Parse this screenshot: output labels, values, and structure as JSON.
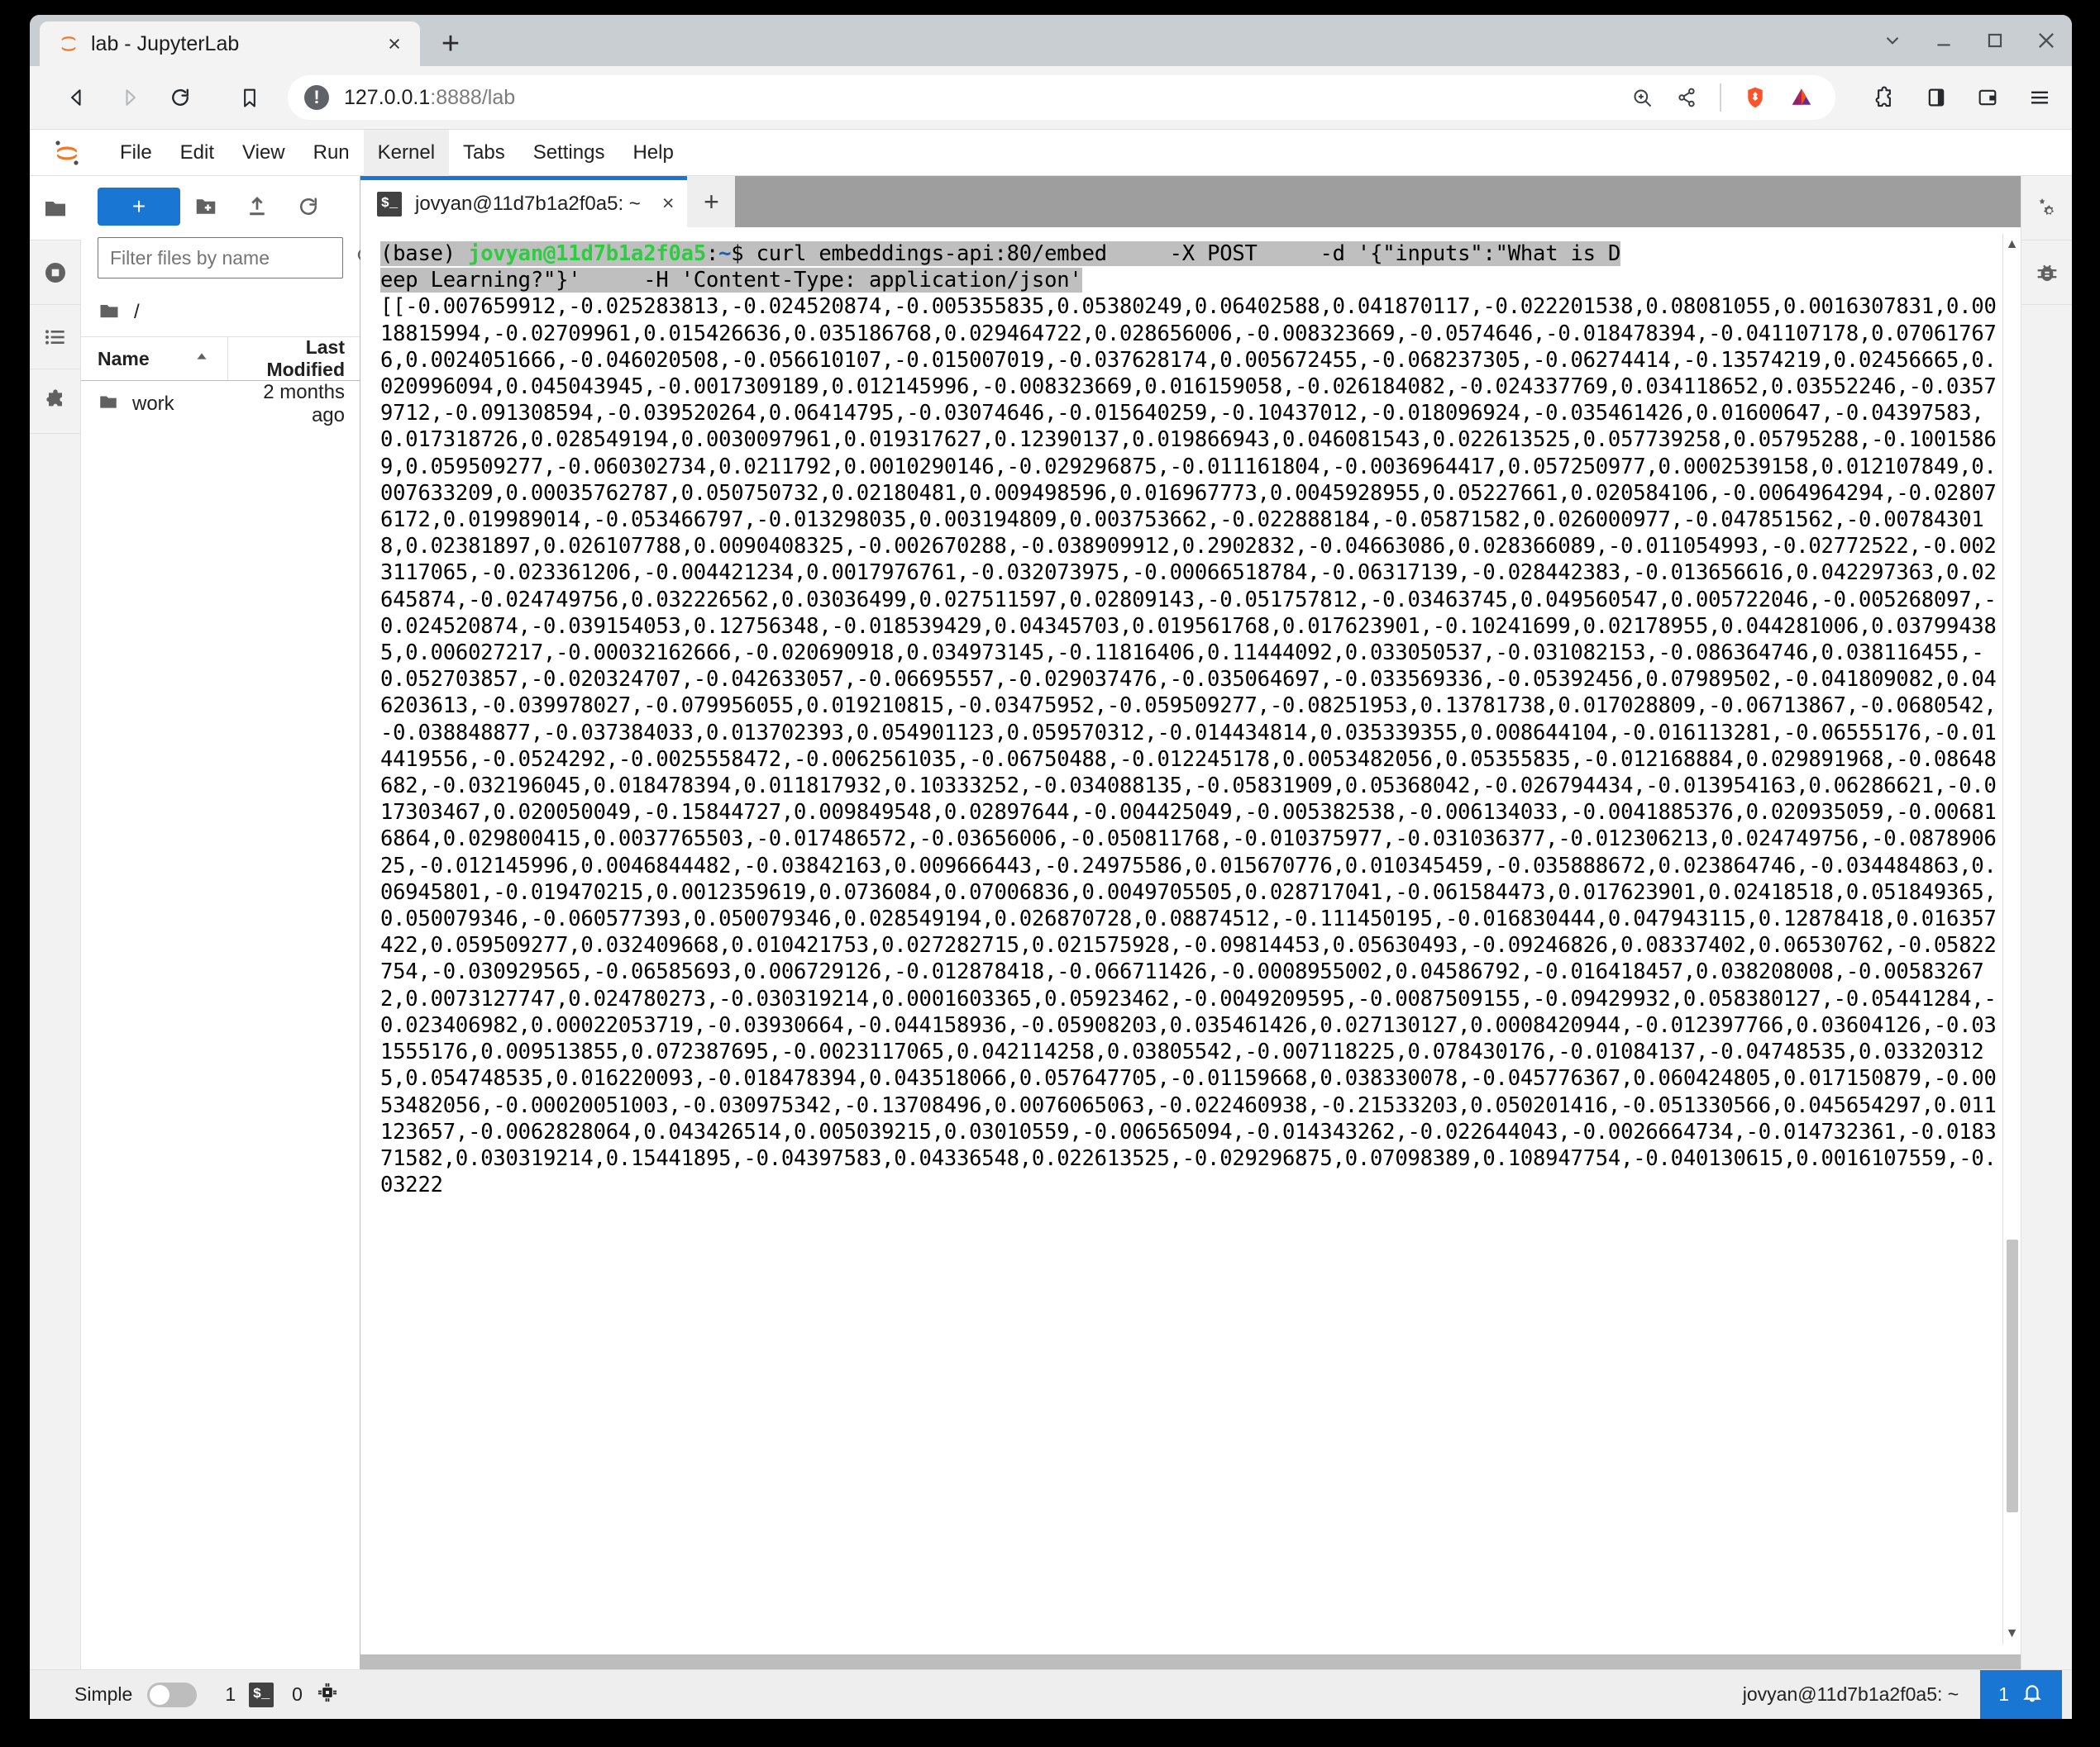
{
  "browser": {
    "tab": {
      "title": "lab - JupyterLab",
      "favicon": "jupyter-logo-icon",
      "close": "×"
    },
    "new_tab_label": "+",
    "window_controls": {
      "tab_search": "chevron-down-icon",
      "minimize": "minimize-icon",
      "maximize": "maximize-icon",
      "close": "close-icon"
    },
    "nav": {
      "back": "back-arrow-icon",
      "forward": "forward-arrow-icon",
      "reload": "reload-icon",
      "bookmark": "bookmark-icon"
    },
    "url": {
      "host": "127.0.0.1",
      "path": ":8888/lab",
      "full": "127.0.0.1:8888/lab",
      "info_icon": "info-circle-icon"
    },
    "url_icons": [
      "zoom-icon",
      "share-icon",
      "brave-shield-icon",
      "bat-rewards-icon"
    ],
    "toolbar_icons": [
      "extensions-puzzle-icon",
      "sidebar-panel-icon",
      "wallet-icon",
      "hamburger-menu-icon"
    ],
    "accent": "#1976d2",
    "brave_orange": "#fb542b"
  },
  "jupyter": {
    "logo": "jupyter-logo-icon",
    "menu": [
      {
        "label": "File",
        "active": false
      },
      {
        "label": "Edit",
        "active": false
      },
      {
        "label": "View",
        "active": false
      },
      {
        "label": "Run",
        "active": false
      },
      {
        "label": "Kernel",
        "active": true
      },
      {
        "label": "Tabs",
        "active": false
      },
      {
        "label": "Settings",
        "active": false
      },
      {
        "label": "Help",
        "active": false
      }
    ],
    "left_activitybar": [
      {
        "name": "file-browser",
        "icon": "folder-icon",
        "active": true
      },
      {
        "name": "running-terminals",
        "icon": "stop-circle-icon",
        "active": false
      },
      {
        "name": "table-of-contents",
        "icon": "list-icon",
        "active": false
      },
      {
        "name": "extension-manager",
        "icon": "puzzle-icon",
        "active": false
      }
    ],
    "right_activitybar": [
      {
        "name": "property-inspector",
        "icon": "gears-icon"
      },
      {
        "name": "debugger",
        "icon": "bug-icon"
      }
    ],
    "filebrowser": {
      "new_launcher_label": "+",
      "tools": [
        {
          "name": "new-folder",
          "icon": "new-folder-icon"
        },
        {
          "name": "upload",
          "icon": "upload-icon"
        },
        {
          "name": "refresh",
          "icon": "refresh-icon"
        }
      ],
      "filter_placeholder": "Filter files by name",
      "filter_value": "",
      "search_icon": "search-icon",
      "breadcrumb": "/",
      "columns": {
        "name": "Name",
        "last_modified": "Last Modified"
      },
      "sort_icon": "sort-ascending-icon",
      "rows": [
        {
          "name": "work",
          "icon": "folder-icon",
          "last_modified": "2 months ago"
        }
      ]
    },
    "main_tab": {
      "label": "jovyan@11d7b1a2f0a5: ~",
      "icon": "terminal-icon",
      "icon_glyph": "$_",
      "close": "×",
      "add_label": "+"
    },
    "statusbar": {
      "simple_label": "Simple",
      "simple_enabled": false,
      "terminals_count": "1",
      "terminal_icon": "terminal-icon",
      "kernels_count": "0",
      "kernel_icon": "cpu-chip-icon",
      "kernel_name": "jovyan@11d7b1a2f0a5: ~",
      "notification_count": "1",
      "notification_icon": "bell-icon"
    }
  },
  "terminal": {
    "prompt": {
      "base": "(base) ",
      "user_host": "jovyan@11d7b1a2f0a5",
      "colon": ":",
      "tilde": "~",
      "dollar": "$ "
    },
    "command_line1": "curl embeddings-api:80/embed     -X POST     -d '{\"inputs\":\"What is D",
    "command_line2": "eep Learning?\"}'     -H 'Content-Type: application/json'",
    "output": "[[-0.007659912,-0.025283813,-0.024520874,-0.005355835,0.05380249,0.06402588,0.041870117,-0.022201538,0.08081055,0.0016307831,0.0018815994,-0.02709961,0.015426636,0.035186768,0.029464722,0.028656006,-0.008323669,-0.0574646,-0.018478394,-0.041107178,0.070617676,0.0024051666,-0.046020508,-0.056610107,-0.015007019,-0.037628174,0.005672455,-0.068237305,-0.06274414,-0.13574219,0.02456665,0.020996094,0.045043945,-0.0017309189,0.012145996,-0.008323669,0.016159058,-0.026184082,-0.024337769,0.034118652,0.03552246,-0.03579712,-0.091308594,-0.039520264,0.06414795,-0.03074646,-0.015640259,-0.10437012,-0.018096924,-0.035461426,0.01600647,-0.04397583,0.017318726,0.028549194,0.0030097961,0.019317627,0.12390137,0.019866943,0.046081543,0.022613525,0.057739258,0.05795288,-0.10015869,0.059509277,-0.060302734,0.0211792,0.0010290146,-0.029296875,-0.011161804,-0.0036964417,0.057250977,0.0002539158,0.012107849,0.007633209,0.00035762787,0.050750732,0.02180481,0.009498596,0.016967773,0.0045928955,0.05227661,0.020584106,-0.0064964294,-0.028076172,0.019989014,-0.053466797,-0.013298035,0.003194809,0.003753662,-0.022888184,-0.05871582,0.026000977,-0.047851562,-0.007843018,0.02381897,0.026107788,0.0090408325,-0.002670288,-0.038909912,0.2902832,-0.04663086,0.028366089,-0.011054993,-0.02772522,-0.0023117065,-0.023361206,-0.004421234,0.0017976761,-0.032073975,-0.00066518784,-0.06317139,-0.028442383,-0.013656616,0.042297363,0.02645874,-0.024749756,0.032226562,0.03036499,0.027511597,0.02809143,-0.051757812,-0.03463745,0.049560547,0.005722046,-0.005268097,-0.024520874,-0.039154053,0.12756348,-0.018539429,0.04345703,0.019561768,0.017623901,-0.10241699,0.02178955,0.044281006,0.037994385,0.006027217,-0.00032162666,-0.020690918,0.034973145,-0.11816406,0.11444092,0.033050537,-0.031082153,-0.086364746,0.038116455,-0.052703857,-0.020324707,-0.042633057,-0.06695557,-0.029037476,-0.035064697,-0.033569336,-0.05392456,0.07989502,-0.041809082,0.046203613,-0.039978027,-0.079956055,0.019210815,-0.03475952,-0.059509277,-0.08251953,0.13781738,0.017028809,-0.06713867,-0.0680542,-0.038848877,-0.037384033,0.013702393,0.054901123,0.059570312,-0.014434814,0.035339355,0.008644104,-0.016113281,-0.06555176,-0.014419556,-0.0524292,-0.0025558472,-0.0062561035,-0.06750488,-0.012245178,0.0053482056,0.05355835,-0.012168884,0.029891968,-0.08648682,-0.032196045,0.018478394,0.011817932,0.10333252,-0.034088135,-0.05831909,0.05368042,-0.026794434,-0.013954163,0.06286621,-0.017303467,0.020050049,-0.15844727,0.009849548,0.02897644,-0.004425049,-0.005382538,-0.006134033,-0.0041885376,0.020935059,-0.006816864,0.029800415,0.0037765503,-0.017486572,-0.03656006,-0.050811768,-0.010375977,-0.031036377,-0.012306213,0.024749756,-0.087890625,-0.012145996,0.0046844482,-0.03842163,0.009666443,-0.24975586,0.015670776,0.010345459,-0.035888672,0.023864746,-0.034484863,0.06945801,-0.019470215,0.0012359619,0.0736084,0.07006836,0.0049705505,0.028717041,-0.061584473,0.017623901,0.02418518,0.051849365,0.050079346,-0.060577393,0.050079346,0.028549194,0.026870728,0.08874512,-0.111450195,-0.016830444,0.047943115,0.12878418,0.016357422,0.059509277,0.032409668,0.010421753,0.027282715,0.021575928,-0.09814453,0.05630493,-0.09246826,0.08337402,0.06530762,-0.05822754,-0.030929565,-0.06585693,0.006729126,-0.012878418,-0.066711426,-0.0008955002,0.04586792,-0.016418457,0.038208008,-0.005832672,0.0073127747,0.024780273,-0.030319214,0.0001603365,0.05923462,-0.0049209595,-0.0087509155,-0.09429932,0.058380127,-0.05441284,-0.023406982,0.00022053719,-0.03930664,-0.044158936,-0.05908203,0.035461426,0.027130127,0.0008420944,-0.012397766,0.03604126,-0.031555176,0.009513855,0.072387695,-0.0023117065,0.042114258,0.03805542,-0.007118225,0.078430176,-0.01084137,-0.04748535,0.033203125,0.054748535,0.016220093,-0.018478394,0.043518066,0.057647705,-0.01159668,0.038330078,-0.045776367,0.060424805,0.017150879,-0.0053482056,-0.00020051003,-0.030975342,-0.13708496,0.0076065063,-0.022460938,-0.21533203,0.050201416,-0.051330566,0.045654297,0.011123657,-0.0062828064,0.043426514,0.005039215,0.03010559,-0.006565094,-0.014343262,-0.022644043,-0.0026664734,-0.014732361,-0.018371582,0.030319214,0.15441895,-0.04397583,0.04336548,0.022613525,-0.029296875,0.07098389,0.108947754,-0.040130615,0.0016107559,-0.03222"
  }
}
